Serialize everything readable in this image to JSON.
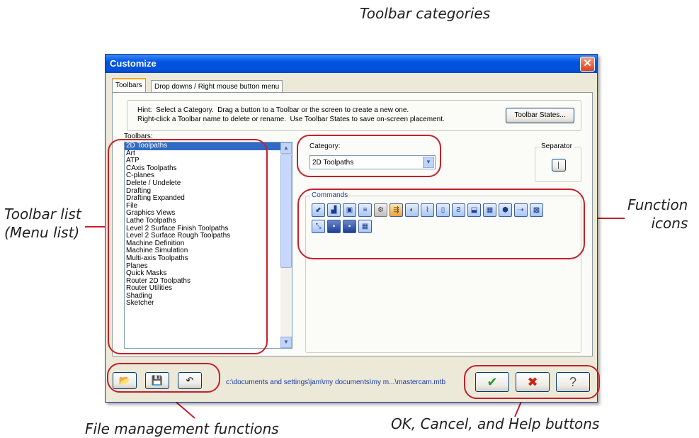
{
  "callouts": {
    "toolbar_categories": "Toolbar categories",
    "toolbar_list": "Toolbar list\n(Menu list)",
    "function_icons": "Function\nicons",
    "file_management": "File management functions",
    "ok_cancel_help": "OK, Cancel, and Help buttons"
  },
  "window": {
    "title": "Customize",
    "close_glyph": "✕"
  },
  "tabs": [
    {
      "label": "Toolbars",
      "active": true
    },
    {
      "label": "Drop downs / Right mouse button menu",
      "active": false
    }
  ],
  "hint": {
    "text": "Hint:  Select a Category.  Drag a button to a Toolbar or the screen to create a new one.\nRight-click a Toolbar name to delete or rename.  Use Toolbar States to save on-screen placement."
  },
  "toolbar_states_button": "Toolbar States...",
  "toolbars": {
    "label": "Toolbars:",
    "items": [
      "2D Toolpaths",
      "Art",
      "ATP",
      "CAxis Toolpaths",
      "C-planes",
      "Delete / Undelete",
      "Drafting",
      "Drafting Expanded",
      "File",
      "Graphics Views",
      "Lathe Toolpaths",
      "Level 2 Surface Finish Toolpaths",
      "Level 2 Surface Rough Toolpaths",
      "Machine Definition",
      "Machine Simulation",
      "Multi-axis Toolpaths",
      "Planes",
      "Quick Masks",
      "Router 2D Toolpaths",
      "Router Utilities",
      "Shading",
      "Sketcher"
    ],
    "selected": "2D Toolpaths",
    "scroll_up_glyph": "▲",
    "scroll_down_glyph": "▼"
  },
  "category": {
    "label": "Category:",
    "value": "2D Toolpaths",
    "arrow_glyph": "▼"
  },
  "separator": {
    "label": "Separator"
  },
  "commands": {
    "label": "Commands",
    "icons": [
      "contour-icon",
      "drill-icon",
      "pocket-icon",
      "facing-icon",
      "gear-icon",
      "transform-icon",
      "circle-mill-icon",
      "thread-icon",
      "slot-icon",
      "helix-icon",
      "engrave-icon",
      "feature-pocket-icon",
      "solid-icon",
      "point-icon",
      "area-icon",
      "trochoidal-icon",
      "block-drill-icon",
      "island-facing-icon",
      "mesh-icon"
    ]
  },
  "footer": {
    "path": "c:\\documents and settings\\jam\\my documents\\my m...\\mastercam.mtb",
    "ok_glyph": "✔",
    "cancel_glyph": "✖",
    "help_glyph": "?"
  },
  "colors": {
    "callout_ring": "#c3202c",
    "titlebar": "#0054e3",
    "selection": "#316ac5",
    "ok": "#1e9e1e",
    "cancel": "#d02010"
  }
}
